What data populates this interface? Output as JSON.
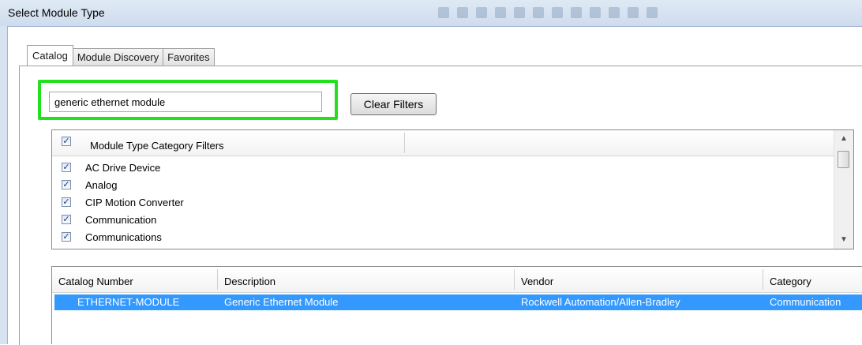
{
  "window": {
    "title": "Select Module Type"
  },
  "tabs": [
    {
      "label": "Catalog"
    },
    {
      "label": "Module Discovery"
    },
    {
      "label": "Favorites"
    }
  ],
  "search": {
    "value": "generic ethernet module"
  },
  "clear_filters_label": "Clear Filters",
  "category_filters": {
    "header": "Module Type Category Filters",
    "items": [
      {
        "label": "AC Drive Device",
        "checked": true
      },
      {
        "label": "Analog",
        "checked": true
      },
      {
        "label": "CIP Motion Converter",
        "checked": true
      },
      {
        "label": "Communication",
        "checked": true
      },
      {
        "label": "Communications",
        "checked": true
      }
    ]
  },
  "results": {
    "columns": [
      "Catalog Number",
      "Description",
      "Vendor",
      "Category"
    ],
    "rows": [
      {
        "catalog_number": "ETHERNET-MODULE",
        "description": "Generic Ethernet Module",
        "vendor": "Rockwell Automation/Allen-Bradley",
        "category": "Communication"
      }
    ]
  },
  "colors": {
    "highlight": "#22e01e",
    "selection": "#3399ff"
  }
}
